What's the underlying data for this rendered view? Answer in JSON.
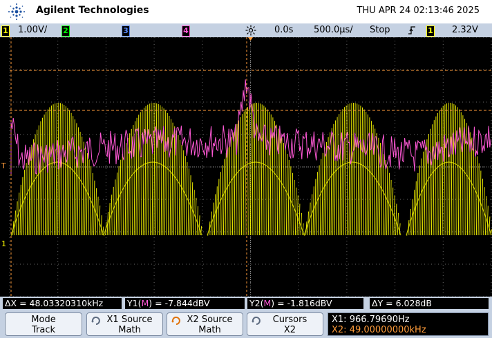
{
  "header": {
    "brand": "Agilent Technologies",
    "datetime": "THU APR 24 02:13:46 2025"
  },
  "status_bar": {
    "ch1_number": "1",
    "ch1_scale": "1.00V/",
    "ch2_number": "2",
    "ch3_number": "3",
    "ch4_number": "4",
    "time_delay": "0.0s",
    "time_scale": "500.0µs/",
    "run_state": "Stop",
    "trigger_edge_icon": "rising-edge-icon",
    "trigger_source": "1",
    "trigger_level": "2.32V"
  },
  "screen": {
    "ch1_marker": "1",
    "trigger_marker": "T"
  },
  "colors": {
    "ch1": "#ffff00",
    "ch2": "#00ff00",
    "ch3": "#5a8cff",
    "math": "#ff59d6",
    "cursor": "#ff9c3a",
    "softkey_bg": "#c5d1e2",
    "grid": "#6a6a6a"
  },
  "measurements": {
    "dx": "ΔX = 48.03320310kHz",
    "y1_prefix": "Y1(",
    "y1_src": "M",
    "y1_suffix": ") = -7.844dBV",
    "y2_prefix": "Y2(",
    "y2_src": "M",
    "y2_suffix": ") = -1.816dBV",
    "dy": "ΔY = 6.028dB"
  },
  "softkeys": [
    {
      "line1": "Mode",
      "line2": "Track",
      "icon": "none"
    },
    {
      "line1": "X1 Source",
      "line2": "Math",
      "icon": "rotate-knob-icon"
    },
    {
      "line1": "X2 Source",
      "line2": "Math",
      "icon": "rotate-knob-icon"
    },
    {
      "line1": "Cursors",
      "line2": "X2",
      "icon": "rotate-knob-icon"
    }
  ],
  "cursor_readout": {
    "x1": "X1: 966.79690Hz",
    "x2": "X2: 49.00000000kHz"
  }
}
